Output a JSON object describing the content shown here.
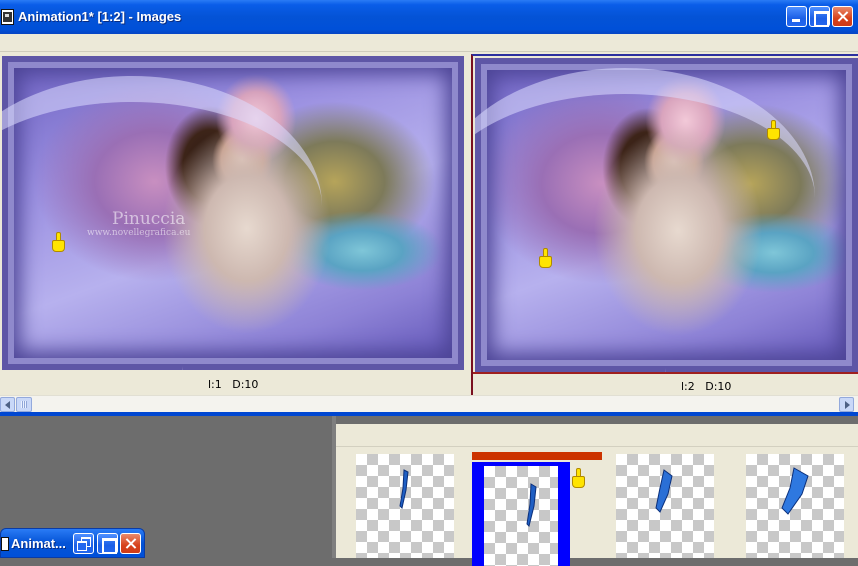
{
  "window": {
    "title": "Animation1* [1:2] - Images",
    "icon": "animation-shop-icon"
  },
  "frames": [
    {
      "label": "l:1   D:10",
      "watermark": "Pinuccia",
      "watermark_url": "www.novellegrafica.eu",
      "selected": false
    },
    {
      "label": "l:2   D:10",
      "selected": true
    }
  ],
  "thumbnails": {
    "count_visible": 4,
    "selected_index": 1
  },
  "minimized_window": {
    "title": "Animat..."
  },
  "colors": {
    "titlebar": "#0453d6",
    "selection": "#0000ff",
    "selection_top": "#cc3300",
    "close_button": "#d7421b"
  }
}
